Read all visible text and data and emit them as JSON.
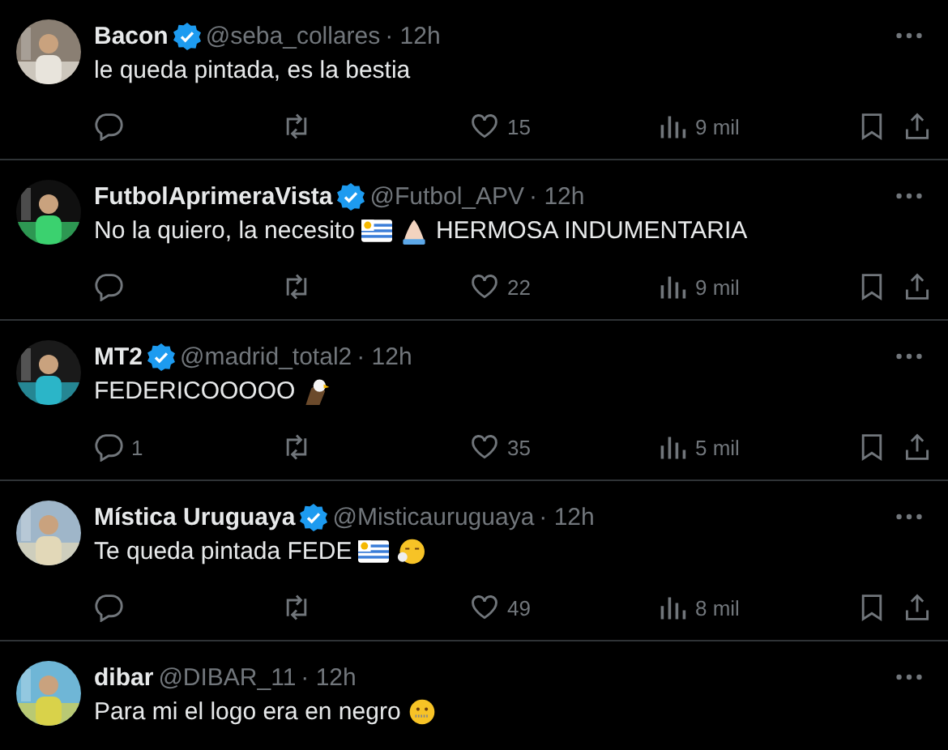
{
  "replies": [
    {
      "name": "Bacon",
      "verified": true,
      "handle": "@seba_collares",
      "time": "· 12h",
      "parts": [
        {
          "kind": "text",
          "text": "le queda pintada, es la bestia"
        }
      ],
      "likes": "15",
      "views": "9 mil"
    },
    {
      "name": "FutbolAprimeraVista",
      "verified": true,
      "handle": "@Futbol_APV",
      "time": "· 12h",
      "parts": [
        {
          "kind": "text",
          "text": "No la quiero, la necesito"
        },
        {
          "kind": "flag"
        },
        {
          "kind": "hands"
        },
        {
          "kind": "text",
          "text": "HERMOSA INDUMENTARIA"
        }
      ],
      "likes": "22",
      "views": "9 mil"
    },
    {
      "name": "MT2",
      "verified": true,
      "handle": "@madrid_total2",
      "time": "· 12h",
      "parts": [
        {
          "kind": "text",
          "text": "FEDERICOOOOO"
        },
        {
          "kind": "eagle"
        }
      ],
      "reply_count": "1",
      "likes": "35",
      "views": "5 mil"
    },
    {
      "name": "Mística Uruguaya",
      "verified": true,
      "handle": "@Misticauruguaya",
      "time": "· 12h",
      "parts": [
        {
          "kind": "text",
          "text": "Te queda pintada FEDE"
        },
        {
          "kind": "flag"
        },
        {
          "kind": "sigh"
        }
      ],
      "likes": "49",
      "views": "8 mil"
    },
    {
      "name": "dibar",
      "verified": false,
      "handle": "@DIBAR_11",
      "time": "· 12h",
      "parts": [
        {
          "kind": "text",
          "text": "Para mi el logo era en negro"
        },
        {
          "kind": "zip"
        }
      ]
    }
  ]
}
